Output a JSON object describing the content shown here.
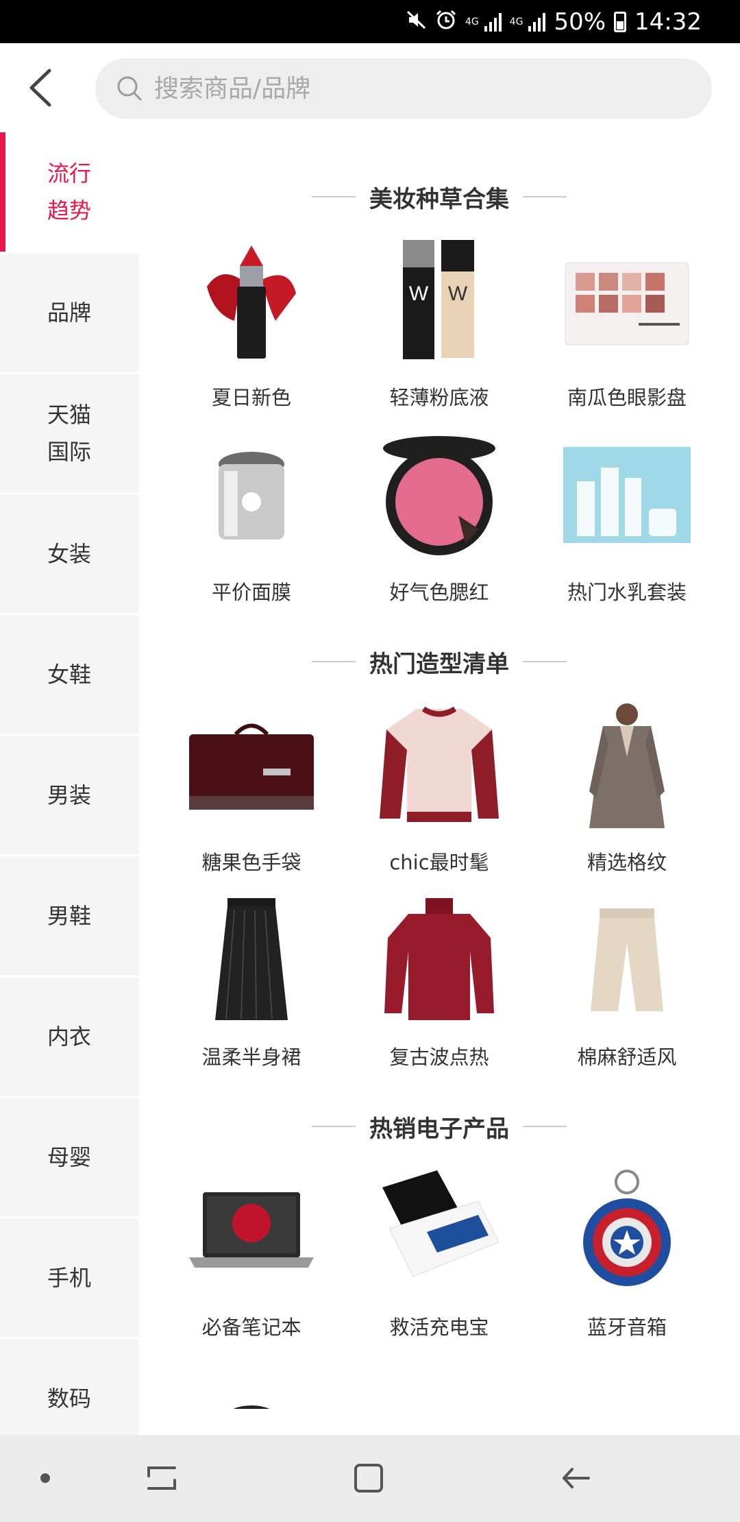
{
  "status_bar": {
    "network_1": "4G",
    "network_2": "4G",
    "battery_percent": "50%",
    "time": "14:32"
  },
  "header": {
    "search_placeholder": "搜索商品/品牌"
  },
  "sidebar": {
    "items": [
      {
        "label": "流行\n趋势",
        "active": true
      },
      {
        "label": "品牌",
        "active": false
      },
      {
        "label": "天猫\n国际",
        "active": false
      },
      {
        "label": "女装",
        "active": false
      },
      {
        "label": "女鞋",
        "active": false
      },
      {
        "label": "男装",
        "active": false
      },
      {
        "label": "男鞋",
        "active": false
      },
      {
        "label": "内衣",
        "active": false
      },
      {
        "label": "母婴",
        "active": false
      },
      {
        "label": "手机",
        "active": false
      },
      {
        "label": "数码",
        "active": false
      }
    ],
    "accent_color": "#e8174a"
  },
  "sections": [
    {
      "title": "美妆种草合集",
      "items": [
        {
          "label": "夏日新色",
          "icon": "lipstick-icon"
        },
        {
          "label": "轻薄粉底液",
          "icon": "foundation-icon"
        },
        {
          "label": "南瓜色眼影盘",
          "icon": "eyeshadow-palette-icon"
        },
        {
          "label": "平价面膜",
          "icon": "face-mask-jar-icon"
        },
        {
          "label": "好气色腮红",
          "icon": "blush-compact-icon"
        },
        {
          "label": "热门水乳套装",
          "icon": "skincare-set-icon"
        }
      ]
    },
    {
      "title": "热门造型清单",
      "items": [
        {
          "label": "糖果色手袋",
          "icon": "handbag-icon"
        },
        {
          "label": "chic最时髦",
          "icon": "jacket-icon"
        },
        {
          "label": "精选格纹",
          "icon": "coat-icon"
        },
        {
          "label": "温柔半身裙",
          "icon": "skirt-icon"
        },
        {
          "label": "复古波点热",
          "icon": "sweater-icon"
        },
        {
          "label": "棉麻舒适风",
          "icon": "pants-icon"
        }
      ]
    },
    {
      "title": "热销电子产品",
      "items": [
        {
          "label": "必备笔记本",
          "icon": "laptop-icon"
        },
        {
          "label": "救活充电宝",
          "icon": "power-bank-icon"
        },
        {
          "label": "蓝牙音箱",
          "icon": "speaker-icon"
        }
      ]
    }
  ]
}
